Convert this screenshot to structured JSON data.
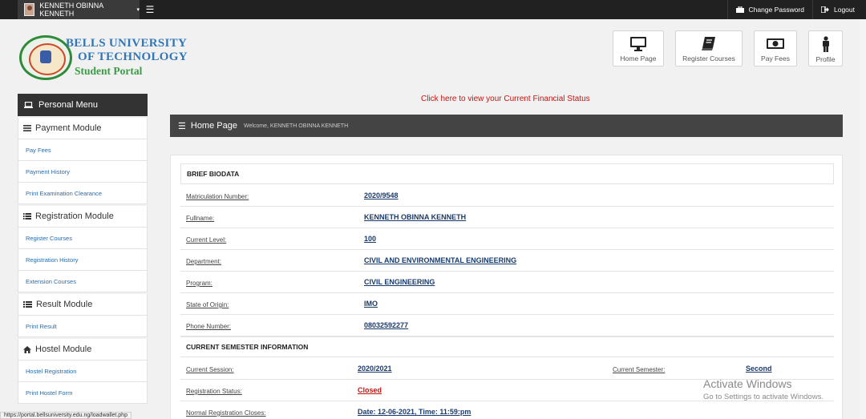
{
  "topbar": {
    "user_name": "KENNETH OBINNA KENNETH",
    "change_password": "Change Password",
    "logout": "Logout"
  },
  "logo": {
    "line1": "BELLS UNIVERSITY",
    "line2": "OF TECHNOLOGY",
    "line3": "Student Portal"
  },
  "quick_buttons": {
    "home": "Home Page",
    "register": "Register Courses",
    "fees": "Pay Fees",
    "profile": "Profile"
  },
  "sidebar": {
    "title": "Personal Menu",
    "payment": {
      "label": "Payment Module",
      "items": [
        "Pay Fees",
        "Payment History",
        "Print Examination Clearance"
      ]
    },
    "registration": {
      "label": "Registration Module",
      "items": [
        "Register Courses",
        "Registration History",
        "Extension Courses"
      ]
    },
    "result": {
      "label": "Result Module",
      "items": [
        "Print Result"
      ]
    },
    "hostel": {
      "label": "Hostel Module",
      "items": [
        "Hostel Registration",
        "Print Hostel Form"
      ]
    }
  },
  "main": {
    "financial_link": "Click here to view your Current Financial Status",
    "home_title": "Home Page",
    "welcome": "Welcome, KENNETH OBINNA KENNETH",
    "biodata_title": "BRIEF BIODATA",
    "biodata": [
      {
        "label": "Matriculation Number:",
        "value": "2020/9548"
      },
      {
        "label": "Fullname:",
        "value": "KENNETH OBINNA KENNETH"
      },
      {
        "label": "Current Level:",
        "value": "100"
      },
      {
        "label": "Department:",
        "value": "CIVIL AND ENVIRONMENTAL ENGINEERING"
      },
      {
        "label": "Program:",
        "value": "CIVIL ENGINEERING"
      },
      {
        "label": "State of Origin:",
        "value": "IMO"
      },
      {
        "label": "Phone Number:",
        "value": "08032592277"
      }
    ],
    "semester_title": "CURRENT SEMESTER INFORMATION",
    "semester": {
      "session_label": "Current Session:",
      "session_value": "2020/2021",
      "semester_label": "Current Semester:",
      "semester_value": "Second",
      "status_label": "Registration Status:",
      "status_value": "Closed",
      "closes_label": "Normal Registration Closes:",
      "closes_value": "Date: 12-06-2021, Time: 11:59:pm"
    }
  },
  "watermark": {
    "line1": "Activate Windows",
    "line2": "Go to Settings to activate Windows."
  },
  "status_bar": {
    "url": "https://portal.bellsuniversity.edu.ng/loadwallet.php"
  },
  "colors": {
    "dark_bar": "#444444",
    "link_blue": "#2a6ba8",
    "alert_red": "#cc1111",
    "value_blue": "#1a3a6b"
  }
}
